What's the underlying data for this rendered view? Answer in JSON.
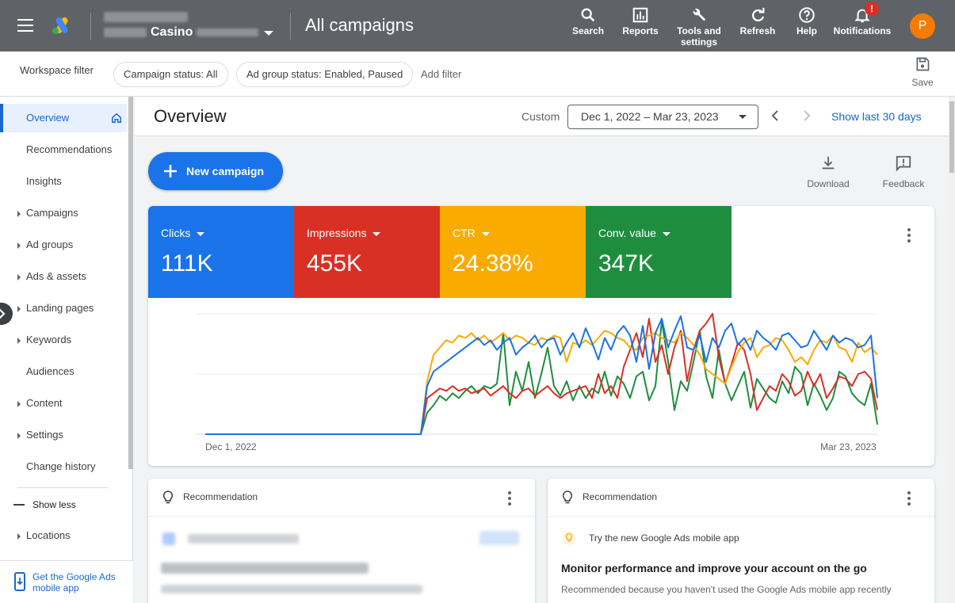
{
  "header": {
    "account_name": "Casino",
    "page_title": "All campaigns",
    "tools": [
      {
        "label": "Search"
      },
      {
        "label": "Reports"
      },
      {
        "label": "Tools and settings"
      },
      {
        "label": "Refresh"
      },
      {
        "label": "Help"
      },
      {
        "label": "Notifications"
      }
    ],
    "notification_badge": "!",
    "avatar_initial": "P"
  },
  "filters": {
    "workspace_label": "Workspace filter",
    "chips": [
      "Campaign status: All",
      "Ad group status: Enabled, Paused"
    ],
    "add_filter": "Add filter",
    "save_label": "Save"
  },
  "sidebar": {
    "items": [
      {
        "label": "Overview"
      },
      {
        "label": "Recommendations"
      },
      {
        "label": "Insights"
      },
      {
        "label": "Campaigns"
      },
      {
        "label": "Ad groups"
      },
      {
        "label": "Ads & assets"
      },
      {
        "label": "Landing pages"
      },
      {
        "label": "Keywords"
      },
      {
        "label": "Audiences"
      },
      {
        "label": "Content"
      },
      {
        "label": "Settings"
      },
      {
        "label": "Change history"
      }
    ],
    "show_less": "Show less",
    "locations": "Locations",
    "mobile_promo": "Get the Google Ads mobile app"
  },
  "overview": {
    "title": "Overview",
    "custom_label": "Custom",
    "date_range": "Dec 1, 2022 – Mar 23, 2023",
    "show_last": "Show last 30 days",
    "new_campaign": "New campaign",
    "download": "Download",
    "feedback": "Feedback"
  },
  "metrics": [
    {
      "label": "Clicks",
      "value": "111K",
      "color": "#1a73e8"
    },
    {
      "label": "Impressions",
      "value": "455K",
      "color": "#d93025"
    },
    {
      "label": "CTR",
      "value": "24.38%",
      "color": "#f9ab00"
    },
    {
      "label": "Conv. value",
      "value": "347K",
      "color": "#1e8e3e"
    }
  ],
  "chart_data": {
    "type": "line",
    "x_start": "Dec 1, 2022",
    "x_end": "Mar 23, 2023",
    "ylim": [
      0,
      100
    ],
    "series": [
      {
        "name": "Clicks",
        "color": "#1a73e8",
        "values": [
          0,
          0,
          0,
          0,
          0,
          0,
          0,
          0,
          0,
          0,
          0,
          0,
          0,
          0,
          0,
          0,
          0,
          0,
          0,
          0,
          0,
          0,
          0,
          0,
          0,
          0,
          0,
          0,
          0,
          0,
          0,
          0,
          0,
          0,
          0,
          40,
          52,
          56,
          60,
          64,
          68,
          72,
          76,
          80,
          74,
          78,
          70,
          76,
          80,
          66,
          72,
          76,
          82,
          72,
          78,
          80,
          66,
          76,
          84,
          72,
          88,
          76,
          62,
          80,
          70,
          84,
          90,
          82,
          60,
          90,
          54,
          84,
          96,
          72,
          86,
          98,
          72,
          70,
          82,
          60,
          80,
          72,
          86,
          92,
          74,
          80,
          70,
          86,
          80,
          76,
          70,
          82,
          84,
          78,
          72,
          74,
          86,
          78,
          70,
          82,
          76,
          80,
          78,
          72,
          74,
          82,
          30
        ]
      },
      {
        "name": "Impressions",
        "color": "#d93025",
        "values": [
          0,
          0,
          0,
          0,
          0,
          0,
          0,
          0,
          0,
          0,
          0,
          0,
          0,
          0,
          0,
          0,
          0,
          0,
          0,
          0,
          0,
          0,
          0,
          0,
          0,
          0,
          0,
          0,
          0,
          0,
          0,
          0,
          0,
          0,
          0,
          30,
          34,
          38,
          36,
          40,
          36,
          38,
          34,
          36,
          38,
          32,
          36,
          40,
          34,
          30,
          36,
          38,
          32,
          36,
          40,
          34,
          30,
          34,
          36,
          38,
          40,
          30,
          50,
          34,
          40,
          30,
          56,
          70,
          84,
          64,
          96,
          60,
          74,
          50,
          72,
          86,
          44,
          70,
          86,
          92,
          100,
          64,
          42,
          58,
          76,
          70,
          50,
          20,
          30,
          40,
          36,
          50,
          44,
          32,
          36,
          52,
          40,
          50,
          30,
          38,
          48,
          46,
          40,
          50,
          52,
          46,
          20
        ]
      },
      {
        "name": "CTR",
        "color": "#f9ab00",
        "values": [
          0,
          0,
          0,
          0,
          0,
          0,
          0,
          0,
          0,
          0,
          0,
          0,
          0,
          0,
          0,
          0,
          0,
          0,
          0,
          0,
          0,
          0,
          0,
          0,
          0,
          0,
          0,
          0,
          0,
          0,
          0,
          0,
          0,
          0,
          0,
          44,
          66,
          72,
          78,
          76,
          82,
          80,
          84,
          78,
          82,
          76,
          80,
          84,
          78,
          82,
          80,
          76,
          74,
          80,
          78,
          82,
          80,
          60,
          76,
          74,
          78,
          74,
          80,
          86,
          84,
          80,
          78,
          72,
          70,
          80,
          82,
          84,
          80,
          78,
          76,
          84,
          80,
          74,
          66,
          54,
          50,
          46,
          42,
          56,
          68,
          76,
          80,
          64,
          72,
          74,
          80,
          78,
          70,
          60,
          64,
          58,
          70,
          78,
          76,
          82,
          72,
          70,
          60,
          76,
          68,
          72,
          66
        ]
      },
      {
        "name": "Conv. value",
        "color": "#1e8e3e",
        "values": [
          0,
          0,
          0,
          0,
          0,
          0,
          0,
          0,
          0,
          0,
          0,
          0,
          0,
          0,
          0,
          0,
          0,
          0,
          0,
          0,
          0,
          0,
          0,
          0,
          0,
          0,
          0,
          0,
          0,
          0,
          0,
          0,
          0,
          0,
          0,
          18,
          24,
          32,
          28,
          34,
          30,
          36,
          40,
          34,
          40,
          38,
          42,
          84,
          24,
          52,
          36,
          60,
          30,
          50,
          72,
          40,
          32,
          44,
          28,
          40,
          30,
          38,
          34,
          52,
          32,
          48,
          42,
          30,
          48,
          52,
          28,
          40,
          94,
          60,
          20,
          44,
          36,
          60,
          86,
          48,
          30,
          70,
          42,
          28,
          40,
          52,
          22,
          46,
          38,
          30,
          26,
          44,
          34,
          56,
          50,
          24,
          42,
          32,
          20,
          30,
          52,
          48,
          34,
          28,
          24,
          42,
          8
        ]
      }
    ]
  },
  "recommendations": [
    {
      "header": "Recommendation"
    },
    {
      "header": "Recommendation",
      "line": "Try the new Google Ads mobile app",
      "title": "Monitor performance and improve your account on the go",
      "description": "Recommended because you haven't used the Google Ads mobile app recently"
    }
  ]
}
